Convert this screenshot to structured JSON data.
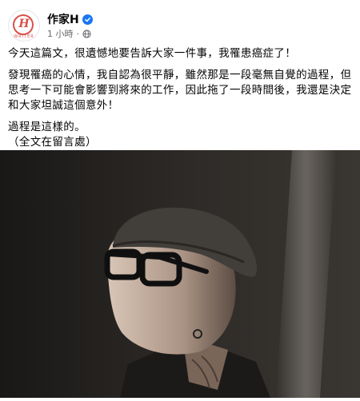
{
  "post": {
    "author": "作家H",
    "avatar_logo_text": "H",
    "avatar_logo_subtext": "WRITER",
    "timestamp": "1 小時",
    "separator": "·",
    "paragraphs": [
      "今天這篇文，很遺憾地要告訴大家一件事，我罹患癌症了！",
      "發現罹癌的心情，我自認為很平靜，雖然那是一段毫無自覺的過程，但\n思考一下可能會影響到將來的工作，因此拖了一段時間後，我還是決定\n和大家坦誠這個意外！",
      "過程是這樣的。\n（全文在留言處）"
    ],
    "photo_icon": "portrait-photo"
  },
  "colors": {
    "verified": "#1877f2",
    "text": "#050505",
    "secondary": "#65676b",
    "logo": "#d9514a"
  }
}
